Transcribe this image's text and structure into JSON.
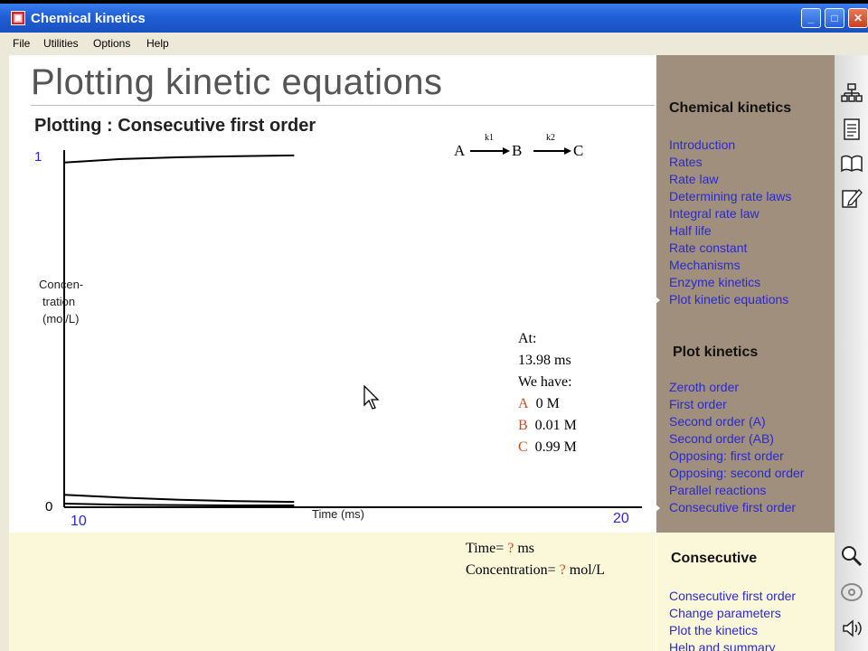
{
  "window": {
    "title": "Chemical kinetics"
  },
  "menu": [
    "File",
    "Utilities",
    "Options",
    "Help"
  ],
  "page": {
    "title": "Plotting kinetic equations",
    "subtitle": "Plotting : Consecutive first order"
  },
  "reaction": {
    "a": "A",
    "b": "B",
    "c": "C",
    "k1": "k1",
    "k2": "k2"
  },
  "chart_data": {
    "type": "line",
    "xlabel": "Time (ms)",
    "ylabel": "Concen-tration (mol/L)",
    "ylabel_lines": [
      "Concen-",
      "tration",
      "(mol/L)"
    ],
    "xlim": [
      10,
      20
    ],
    "ylim": [
      0,
      1
    ],
    "x_ticks": [
      "10",
      "20"
    ],
    "y_ticks": [
      "1",
      "0"
    ],
    "series": [
      {
        "x": [
          10,
          11,
          12,
          13,
          13.98
        ],
        "y": [
          0.97,
          0.98,
          0.985,
          0.988,
          0.99
        ]
      },
      {
        "x": [
          10,
          11,
          12,
          13,
          13.98
        ],
        "y": [
          0.03,
          0.022,
          0.016,
          0.012,
          0.01
        ]
      },
      {
        "x": [
          10,
          11,
          12,
          13,
          13.98
        ],
        "y": [
          0.005,
          0.002,
          0.001,
          0.0,
          0.0
        ]
      }
    ]
  },
  "readout": {
    "at_label": "At:",
    "time": "13.98 ms",
    "we_have": "We have:",
    "species": [
      {
        "name": "A",
        "value": "0 M"
      },
      {
        "name": "B",
        "value": "0.01 M"
      },
      {
        "name": "C",
        "value": "0.99 M"
      }
    ]
  },
  "query": {
    "time_label": "Time=",
    "time_value": "?",
    "time_unit": "ms",
    "conc_label": "Concentration=",
    "conc_value": "?",
    "conc_unit": "mol/L"
  },
  "sidebar": {
    "section1": {
      "heading": "Chemical kinetics",
      "items": [
        "Introduction",
        "Rates",
        "Rate law",
        "Determining rate laws",
        "Integral rate law",
        "Half life",
        "Rate constant",
        "Mechanisms",
        "Enzyme kinetics",
        "Plot kinetic equations"
      ]
    },
    "section2": {
      "heading": "Plot kinetics",
      "items": [
        "Zeroth order",
        "First order",
        "Second order (A)",
        "Second order (AB)",
        "Opposing: first order",
        "Opposing: second order",
        "Parallel reactions",
        "Consecutive first order"
      ]
    },
    "section3": {
      "heading": "Consecutive",
      "items": [
        "Consecutive first order",
        "Change parameters",
        "Plot the kinetics",
        "Help and summary"
      ]
    }
  },
  "toolbar": [
    "sitemap-icon",
    "notes-icon",
    "book-icon",
    "edit-icon",
    "magnifier-icon",
    "cd-icon",
    "speaker-icon"
  ],
  "colors": {
    "accent": "#c8501e",
    "link": "#2a2ad0",
    "sidebar": "#a08f7c",
    "panel": "#fbf8da"
  }
}
